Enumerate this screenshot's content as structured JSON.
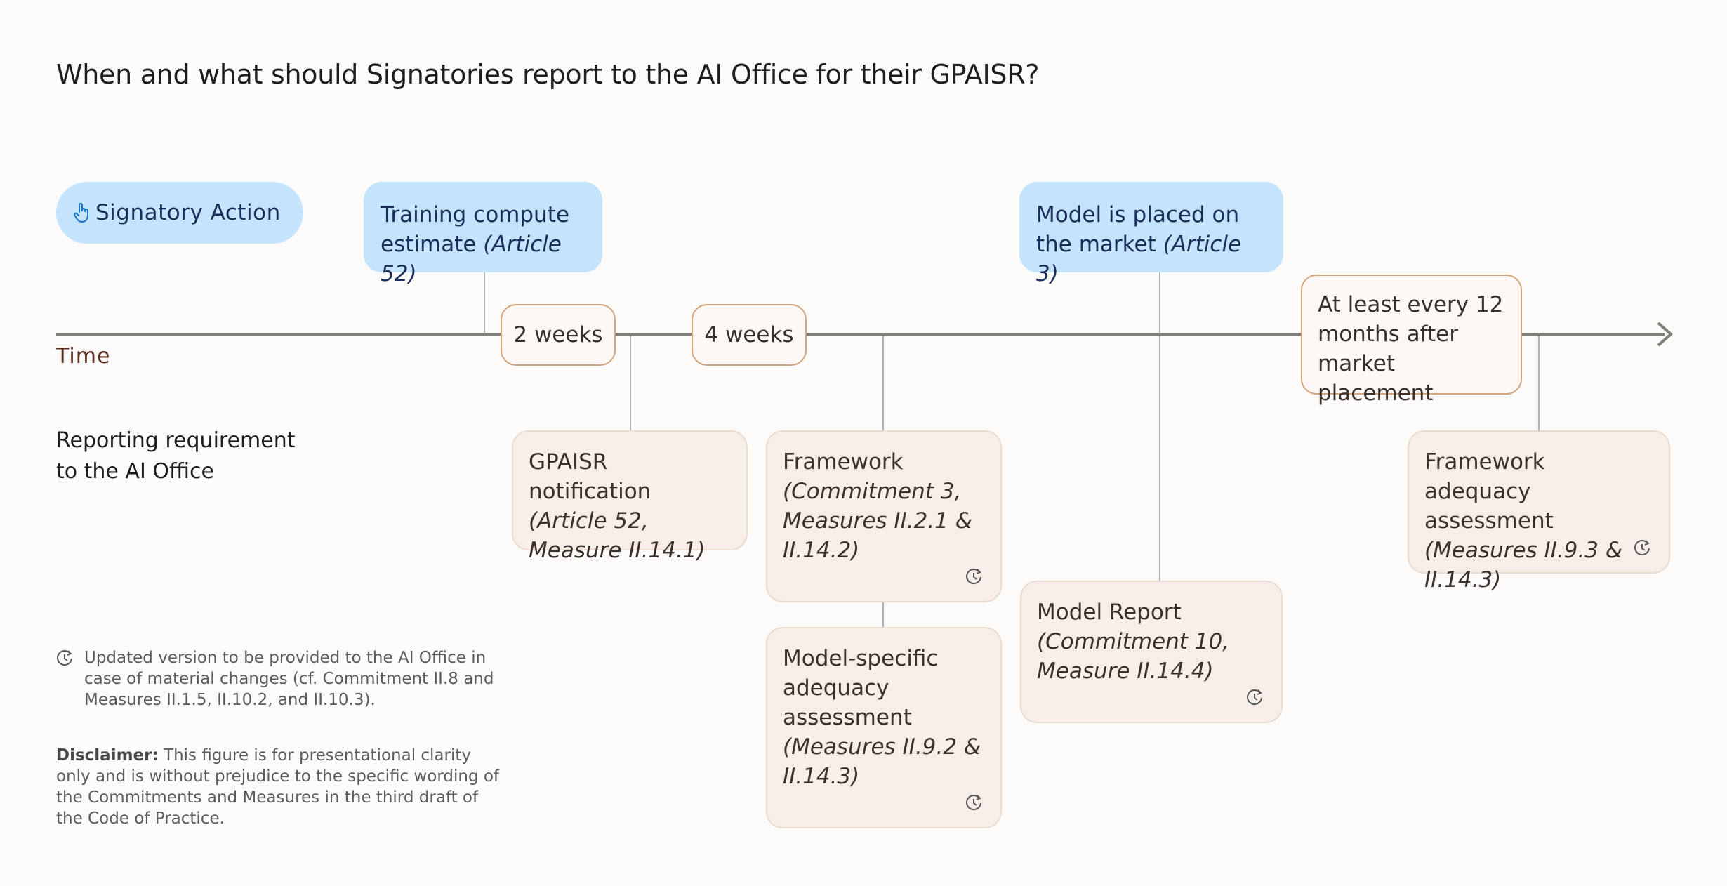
{
  "title": "When and what should Signatories report to the AI Office for their GPAISR?",
  "legend": {
    "signatory_action_label": "Signatory Action",
    "signatory_action_icon": "pointing-hand-icon"
  },
  "timeline": {
    "axis_label": "Time"
  },
  "events": {
    "training": {
      "text": "Training compute estimate",
      "ref": "(Article 52)"
    },
    "market": {
      "text": "Model is placed on the market",
      "ref": "(Article 3)"
    }
  },
  "durations": {
    "two_weeks": "2 weeks",
    "four_weeks": "4 weeks",
    "annual": "At least every 12 months after market placement"
  },
  "reporting_label": "Reporting requirement to the AI Office",
  "requirements": {
    "gpaisr": {
      "title": "GPAISR notification",
      "ref": "(Article 52, Measure II.14.1)",
      "updated": false
    },
    "framework": {
      "title": "Framework",
      "ref": "(Commitment 3, Measures II.2.1 & II.14.2)",
      "updated": true
    },
    "model_specific": {
      "title": "Model-specific adequacy assessment",
      "ref": "(Measures II.9.2 & II.14.3)",
      "updated": true
    },
    "model_report": {
      "title": "Model Report",
      "ref": "(Commitment 10, Measure II.14.4)",
      "updated": true
    },
    "framework_adequacy": {
      "title": "Framework adequacy assessment",
      "ref": "(Measures II.9.3 & II.14.3)",
      "updated": true
    }
  },
  "footnote": "Updated version to be provided to the AI Office in case of material changes (cf. Commitment II.8 and Measures II.1.5, II.10.2, and II.10.3).",
  "disclaimer": {
    "label": "Disclaimer:",
    "text": " This figure is for presentational clarity only and is without prejudice to the specific wording of the Commitments and Measures in the third draft of the Code of Practice."
  },
  "colors": {
    "action_bg": "#c3e4fb",
    "requirement_bg": "#f7ede9",
    "duration_border": "#d3a57e",
    "timeline": "#7f7f78"
  }
}
